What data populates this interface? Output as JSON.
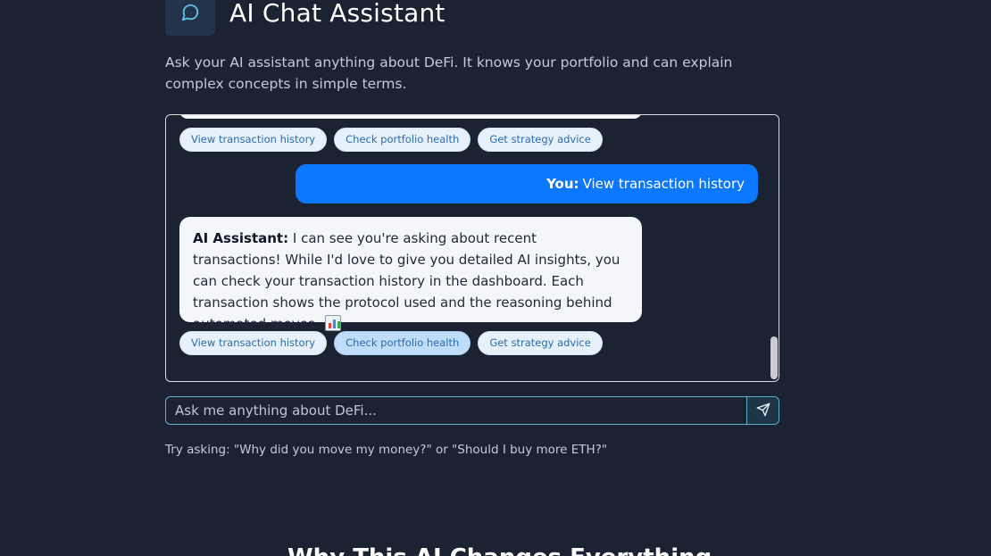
{
  "header": {
    "icon": "chat-bubble-icon",
    "title": "AI Chat Assistant"
  },
  "subtitle": "Ask your AI assistant anything about DeFi. It knows your portfolio and can explain complex concepts in simple terms.",
  "chat": {
    "quick_replies_top": [
      "View transaction history",
      "Check portfolio health",
      "Get strategy advice"
    ],
    "user_message": {
      "sender": "You:",
      "text": "View transaction history"
    },
    "ai_message": {
      "sender": "AI Assistant:",
      "text": "I can see you're asking about recent transactions! While I'd love to give you detailed AI insights, you can check your transaction history in the dashboard. Each transaction shows the protocol used and the reasoning behind automated moves.",
      "emoji": "bar-chart-icon"
    },
    "quick_replies_bottom": [
      "View transaction history",
      "Check portfolio health",
      "Get strategy advice"
    ],
    "active_quick_reply": "Check portfolio health"
  },
  "input": {
    "placeholder": "Ask me anything about DeFi...",
    "send_icon": "send-icon"
  },
  "hint": "Try asking: \"Why did you move my money?\" or \"Should I buy more ETH?\"",
  "next_section_title": "Why This AI Changes Everything",
  "colors": {
    "background": "#1b2232",
    "user_bubble": "#0b78ff",
    "ai_bubble": "#f4f6f9",
    "quick_reply_bg": "#e6f1fc",
    "quick_reply_text": "#2b6cb0",
    "input_border": "#5fb2cf"
  }
}
